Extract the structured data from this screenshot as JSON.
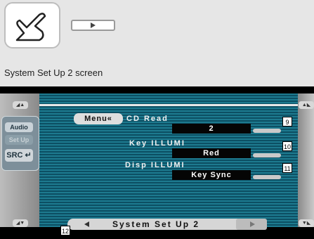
{
  "caption": "System Set Up 2 screen",
  "side_panel": {
    "audio": "Audio",
    "setup": "Set Up",
    "src": "SRC"
  },
  "menu_label": "Menu«",
  "settings": [
    {
      "label": "CD Read",
      "value": "2",
      "tag": "9"
    },
    {
      "label": "Key ILLUMI",
      "value": "Red",
      "tag": "10"
    },
    {
      "label": "Disp ILLUMI",
      "value": "Key Sync",
      "tag": "11"
    }
  ],
  "bottom": {
    "title": "System Set Up 2",
    "tag": "12"
  },
  "icons": [
    "hand-pointer-icon",
    "play-icon",
    "prev-arrow-icon",
    "next-arrow-icon"
  ]
}
